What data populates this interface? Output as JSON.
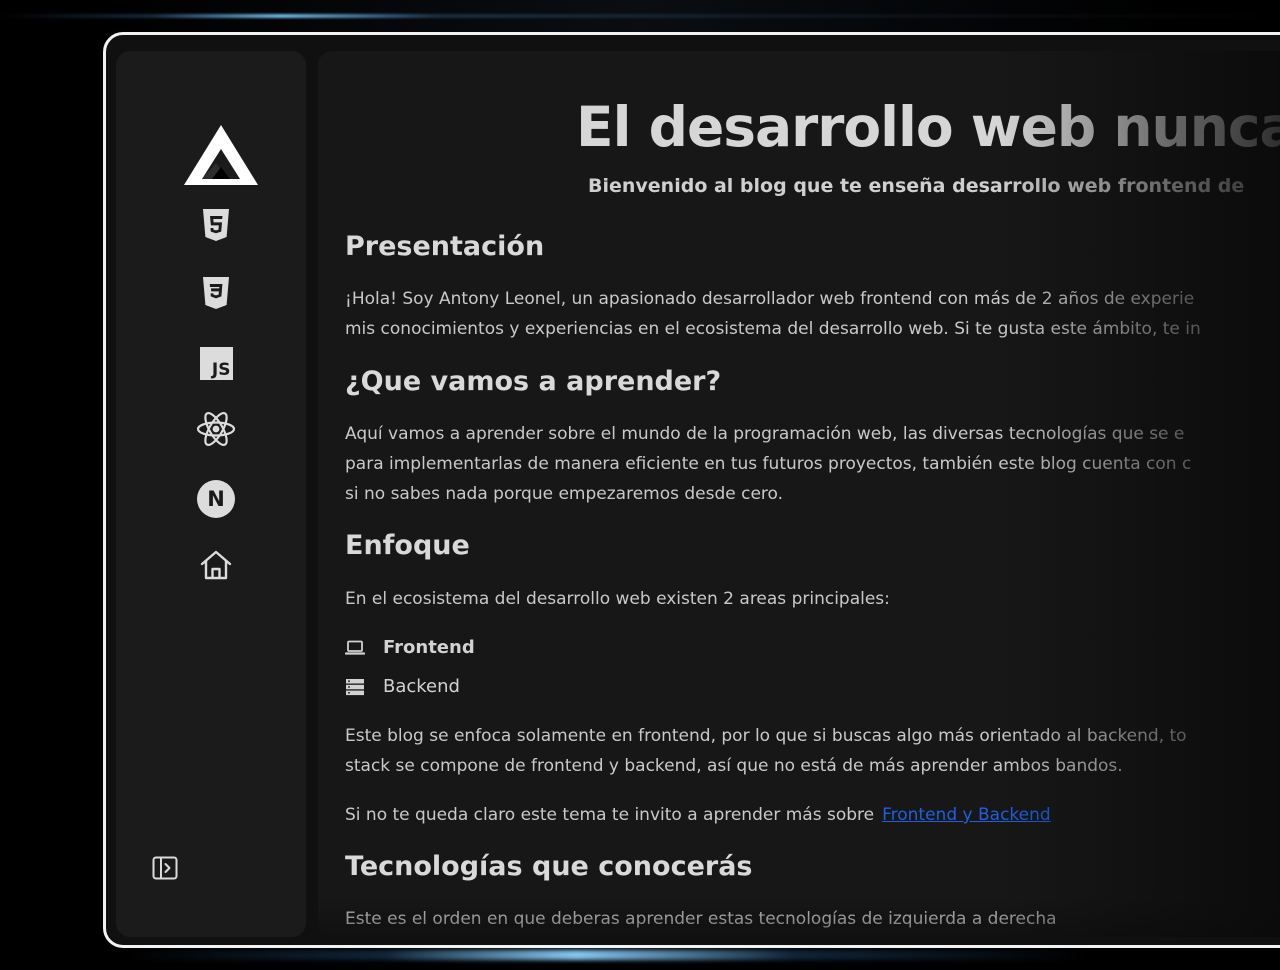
{
  "sidebar": {
    "logo_icon": "triangle-logo",
    "items": [
      {
        "name": "html5",
        "icon": "html5-icon"
      },
      {
        "name": "css3",
        "icon": "css3-icon"
      },
      {
        "name": "javascript",
        "icon": "js-icon",
        "label": "JS"
      },
      {
        "name": "react",
        "icon": "react-icon"
      },
      {
        "name": "nextjs",
        "icon": "nextjs-icon",
        "label": "N"
      },
      {
        "name": "home",
        "icon": "home-icon"
      }
    ],
    "collapse_icon": "sidebar-toggle-icon"
  },
  "hero": {
    "title": "El desarrollo web nunca",
    "subtitle": "Bienvenido al blog que te enseña desarrollo web frontend de"
  },
  "sections": {
    "presentacion": {
      "heading": "Presentación",
      "line1": "¡Hola! Soy Antony Leonel, un apasionado desarrollador web frontend con más de 2 años de experie",
      "line2": "mis conocimientos y experiencias en el ecosistema del desarrollo web. Si te gusta este ámbito, te in"
    },
    "aprender": {
      "heading": "¿Que vamos a aprender?",
      "line1": "Aquí vamos a aprender sobre el mundo de la programación web, las diversas tecnologías que se e",
      "line2": "para implementarlas de manera eficiente en tus futuros proyectos, también este blog cuenta con c",
      "line3": "si no sabes nada porque empezaremos desde cero."
    },
    "enfoque": {
      "heading": "Enfoque",
      "intro": "En el ecosistema del desarrollo web existen 2 areas principales:",
      "areas": [
        {
          "label": "Frontend",
          "icon": "laptop-icon"
        },
        {
          "label": "Backend",
          "icon": "server-icon"
        }
      ],
      "line1": "Este blog se enfoca solamente en frontend, por lo que si buscas algo más orientado al backend, to",
      "line2": "stack se compone de frontend y backend, así que no está de más aprender ambos bandos.",
      "invite_text": "Si no te queda claro este tema te invito a aprender más sobre",
      "invite_link": "Frontend y Backend"
    },
    "tecnologias": {
      "heading": "Tecnologías que conocerás",
      "line1": "Este es el orden en que deberas aprender estas tecnologías de izquierda a derecha"
    }
  },
  "colors": {
    "background": "#000000",
    "frame_border": "#f2f2f2",
    "sidebar": "#1b1b1b",
    "main": "#171717",
    "link": "#1f5fe0",
    "glow": "#8cd2ff"
  }
}
